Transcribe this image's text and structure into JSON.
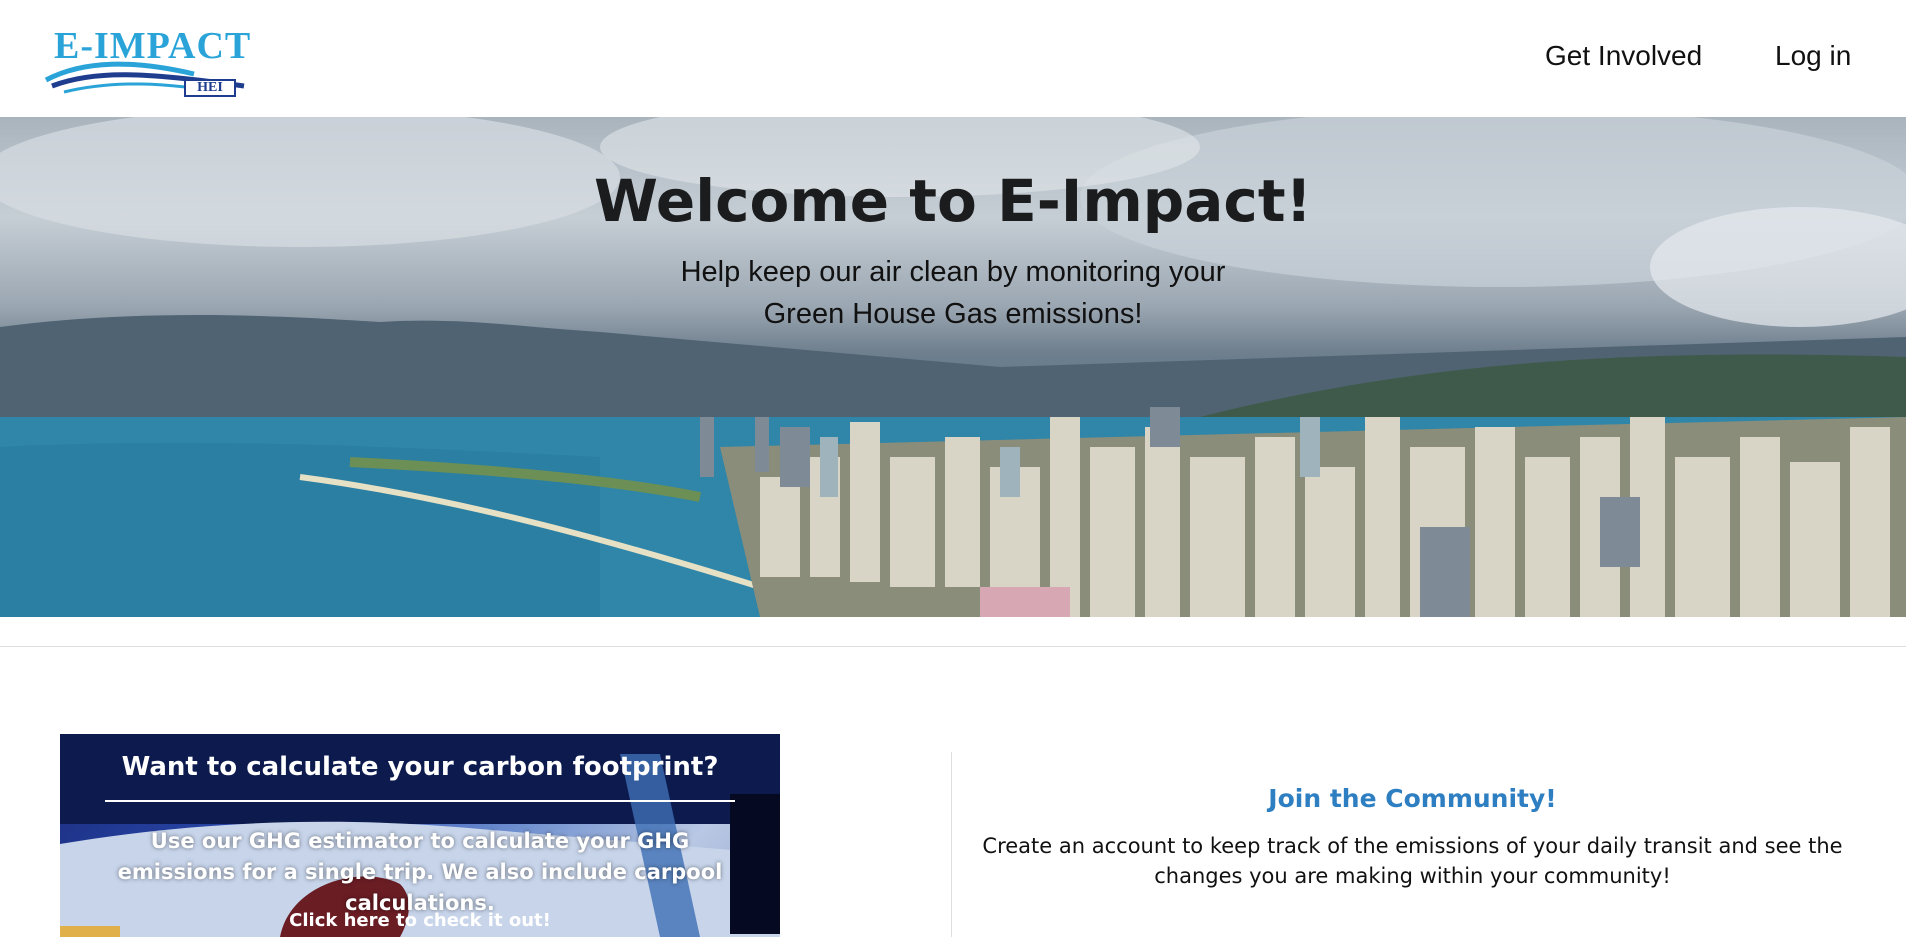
{
  "nav": {
    "logo_text": "E-IMPACT",
    "logo_badge": "HEI",
    "links": [
      {
        "label": "Get Involved"
      },
      {
        "label": "Log in"
      }
    ]
  },
  "hero": {
    "title": "Welcome to E-Impact!",
    "subtitle": "Help keep our air clean by monitoring your Green House Gas emissions!"
  },
  "cards": {
    "calculator": {
      "title": "Want to calculate your carbon footprint?",
      "body": "Use our GHG estimator to calculate your GHG emissions for a single trip. We also include carpool calculations.",
      "link": "Click here to check it out!"
    },
    "community": {
      "title": "Join the Community!",
      "body": "Create an account to keep track of the emissions of your daily transit and see the changes you are making within your community!"
    }
  },
  "colors": {
    "logo": "#2aa4d8",
    "logo_dark": "#1e3d8f",
    "accent_link": "#2e7ec2",
    "ocean": "#2d82a6"
  }
}
